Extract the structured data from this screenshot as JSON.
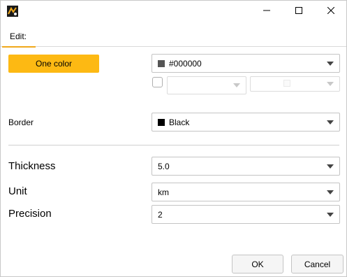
{
  "titlebar": {
    "app_icon": "app-logo-icon",
    "minimize_icon": "minimize-icon",
    "maximize_icon": "maximize-icon",
    "close_icon": "close-icon"
  },
  "tabs": [
    {
      "label": "Edit:",
      "active": true
    }
  ],
  "color_section": {
    "one_color_label": "One color",
    "color_select": {
      "value": "#000000",
      "swatch": "#555555"
    },
    "checkbox_checked": false,
    "secondary_select_1": {
      "value": ""
    },
    "secondary_select_2": {
      "value": ""
    }
  },
  "border": {
    "label": "Border",
    "select": {
      "value": "Black",
      "swatch": "#000000"
    }
  },
  "thickness": {
    "label": "Thickness",
    "value": "5.0"
  },
  "unit": {
    "label": "Unit",
    "value": "km"
  },
  "precision": {
    "label": "Precision",
    "value": "2"
  },
  "footer": {
    "ok_label": "OK",
    "cancel_label": "Cancel"
  },
  "colors": {
    "accent": "#fdb913",
    "tab_underline": "#f0a81a"
  }
}
